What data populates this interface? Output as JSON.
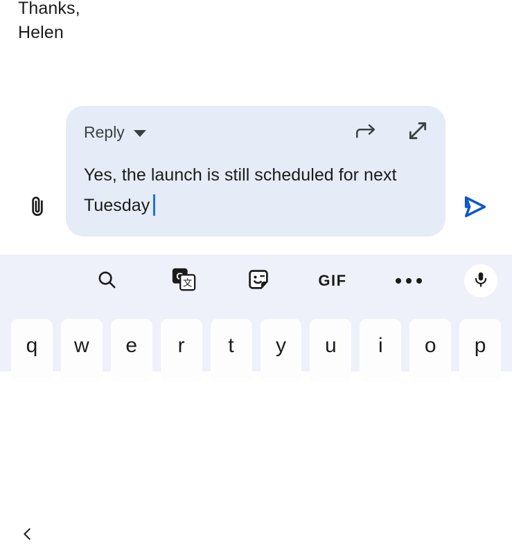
{
  "email_tail": {
    "line1": "Thanks,",
    "line2": "Helen"
  },
  "compose": {
    "mode_label": "Reply",
    "mode_caret_icon": "chevron-down-icon",
    "forward_icon": "forward-arrow-icon",
    "expand_icon": "expand-diagonal-icon",
    "attach_icon": "paperclip-icon",
    "send_icon": "send-icon",
    "body_text": "Yes, the launch is still scheduled for next Tuesday",
    "cursor_color": "#1a73e8",
    "card_color": "#e5ecf7"
  },
  "keyboard": {
    "background": "#eef1fa",
    "toolbar": [
      {
        "name": "back-chevron-icon",
        "label": ""
      },
      {
        "name": "search-icon",
        "label": ""
      },
      {
        "name": "google-translate-icon",
        "label": ""
      },
      {
        "name": "sticker-icon",
        "label": ""
      },
      {
        "name": "gif-icon",
        "label": "GIF"
      },
      {
        "name": "more-options-icon",
        "label": ""
      },
      {
        "name": "microphone-icon",
        "label": ""
      }
    ],
    "row1": [
      "q",
      "w",
      "e",
      "r",
      "t",
      "y",
      "u",
      "i",
      "o",
      "p"
    ]
  }
}
